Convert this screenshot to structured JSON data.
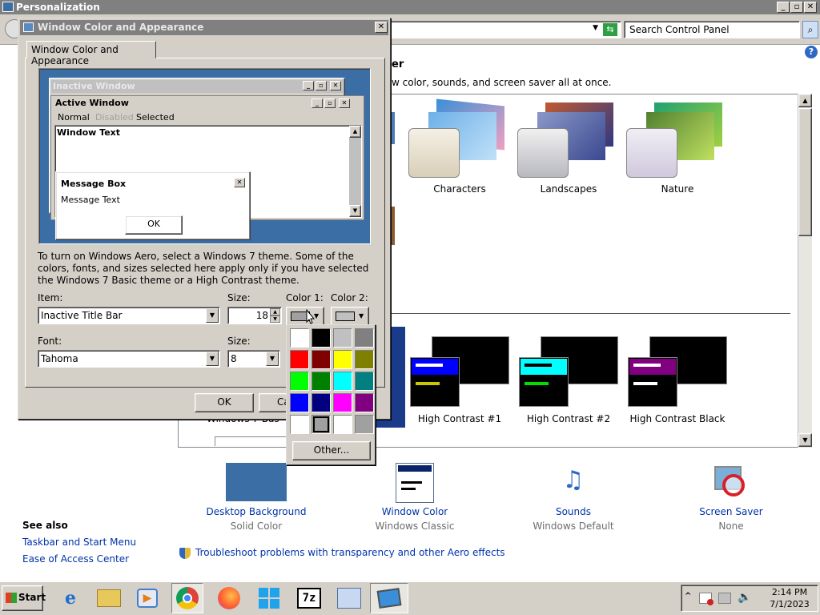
{
  "main_window": {
    "title": "Personalization",
    "search_placeholder": "Search Control Panel",
    "heading_tail": "er",
    "subtitle_tail": "w color, sounds, and screen saver all at once.",
    "themes_row1": [
      "Characters",
      "Landscapes",
      "Nature"
    ],
    "themes_row2": [
      "High Contrast #1",
      "High Contrast #2",
      "High Contrast Black"
    ],
    "basic_theme_partial": "Windows 7 Basic",
    "bottom_items": [
      {
        "label": "Desktop Background",
        "sub": "Solid Color"
      },
      {
        "label": "Window Color",
        "sub": "Windows Classic"
      },
      {
        "label": "Sounds",
        "sub": "Windows Default"
      },
      {
        "label": "Screen Saver",
        "sub": "None"
      }
    ],
    "see_also": {
      "title": "See also",
      "links": [
        "Taskbar and Start Menu",
        "Ease of Access Center"
      ]
    },
    "troubleshoot_link": "Troubleshoot problems with transparency and other Aero effects"
  },
  "dialog": {
    "title": "Window Color and Appearance",
    "tab": "Window Color and Appearance",
    "preview": {
      "inactive_window": "Inactive Window",
      "active_window": "Active Window",
      "menu": [
        "Normal",
        "Disabled",
        "Selected"
      ],
      "window_text": "Window Text",
      "message_box": "Message Box",
      "message_text": "Message Text",
      "ok": "OK"
    },
    "info_text": "To turn on Windows Aero, select a Windows 7 theme.  Some of the colors, fonts, and sizes selected here apply only if you have selected the Windows 7 Basic theme or a High Contrast theme.",
    "item_label": "Item:",
    "item_value": "Inactive Title Bar",
    "size_label": "Size:",
    "size_value": "18",
    "color1_label": "Color 1:",
    "color2_label": "Color 2:",
    "font_label": "Font:",
    "font_value": "Tahoma",
    "font_size_label": "Size:",
    "font_size_value": "8",
    "ok_button": "OK",
    "cancel_button_partial": "Ca",
    "other_button": "Other...",
    "palette_colors": [
      "#ffffff",
      "#000000",
      "#c0c0c0",
      "#808080",
      "#ff0000",
      "#800000",
      "#ffff00",
      "#808000",
      "#00ff00",
      "#008000",
      "#00ffff",
      "#008080",
      "#0000ff",
      "#000080",
      "#ff00ff",
      "#800080",
      "#ffffff",
      "#a0a0a0",
      "#ffffff",
      "#a0a0a0"
    ]
  },
  "taskbar": {
    "start": "Start",
    "time": "2:14 PM",
    "date": "7/1/2023"
  },
  "colors": {
    "desktop_background": "#3a6ea5",
    "title_inactive": "#808080",
    "face": "#d4d0c8"
  }
}
